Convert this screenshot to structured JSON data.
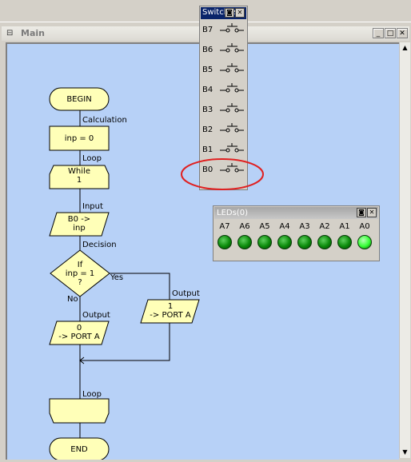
{
  "main_window": {
    "title": "Main"
  },
  "flowchart": {
    "begin": "BEGIN",
    "calc_label": "Calculation",
    "calc_text": "inp = 0",
    "loop_label": "Loop",
    "while_text": "While\n1",
    "input_label": "Input",
    "input_text": "B0 ->\ninp",
    "decision_label": "Decision",
    "decision_text": "If\ninp = 1\n?",
    "yes": "Yes",
    "no": "No",
    "output_left_label": "Output",
    "output_left_text": "0\n-> PORT A",
    "output_right_label": "Output",
    "output_right_text": "1\n-> PORT A",
    "loop_end_label": "Loop",
    "end": "END"
  },
  "switches_window": {
    "title": "Switches",
    "items": [
      {
        "label": "B7"
      },
      {
        "label": "B6"
      },
      {
        "label": "B5"
      },
      {
        "label": "B4"
      },
      {
        "label": "B3"
      },
      {
        "label": "B2"
      },
      {
        "label": "B1"
      },
      {
        "label": "B0"
      }
    ]
  },
  "leds_window": {
    "title": "LEDs(0)",
    "items": [
      {
        "label": "A7",
        "on": false
      },
      {
        "label": "A6",
        "on": false
      },
      {
        "label": "A5",
        "on": false
      },
      {
        "label": "A4",
        "on": false
      },
      {
        "label": "A3",
        "on": false
      },
      {
        "label": "A2",
        "on": false
      },
      {
        "label": "A1",
        "on": false
      },
      {
        "label": "A0",
        "on": true
      }
    ]
  },
  "colors": {
    "canvas_bg": "#b7d1f7",
    "shape_fill": "#ffffb8",
    "led_off": "#0a8a0a",
    "led_on": "#33ff33",
    "highlight_ellipse": "#e02020"
  }
}
